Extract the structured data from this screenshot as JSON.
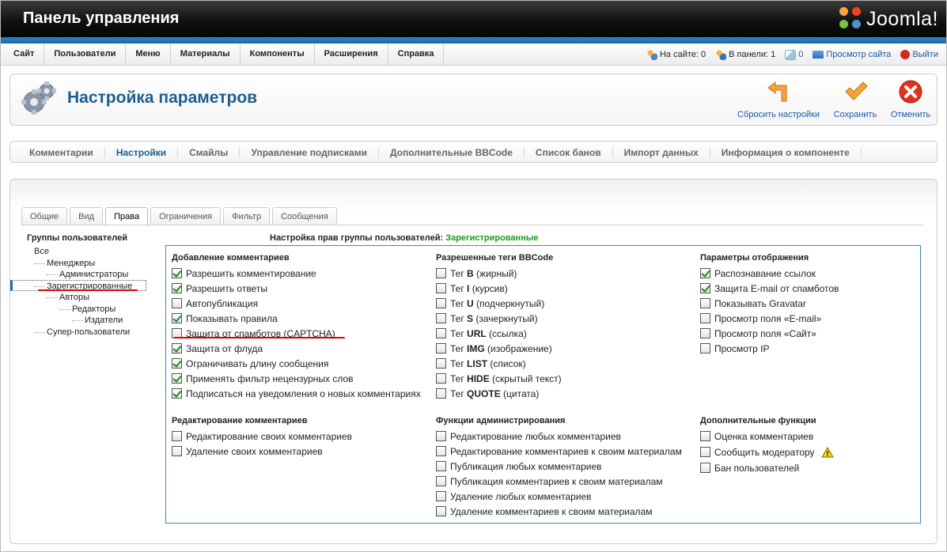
{
  "header": {
    "title": "Панель управления",
    "logo_text": "Joomla!"
  },
  "menu": [
    "Сайт",
    "Пользователи",
    "Меню",
    "Материалы",
    "Компоненты",
    "Расширения",
    "Справка"
  ],
  "status": {
    "on_site": "На сайте: 0",
    "in_panel": "В панели: 1",
    "messages": "0",
    "preview": "Просмотр сайта",
    "logout": "Выйти"
  },
  "toolbar": {
    "title": "Настройка параметров",
    "reset_label": "Сбросить настройки",
    "save_label": "Сохранить",
    "cancel_label": "Отменить"
  },
  "submenu": [
    "Комментарии",
    "Настройки",
    "Смайлы",
    "Управление подписками",
    "Дополнительные BBCode",
    "Список банов",
    "Импорт данных",
    "Информация о компоненте"
  ],
  "submenu_active": 1,
  "tabs": [
    "Общие",
    "Вид",
    "Права",
    "Ограничения",
    "Фильтр",
    "Сообщения"
  ],
  "tabs_active": 2,
  "groups": {
    "title": "Группы пользователей",
    "items": [
      {
        "label": "Все",
        "level": 0
      },
      {
        "label": "Менеджеры",
        "level": 1
      },
      {
        "label": "Администраторы",
        "level": 2
      },
      {
        "label": "Зарегистрированные",
        "level": 1
      },
      {
        "label": "Авторы",
        "level": 2
      },
      {
        "label": "Редакторы",
        "level": 3
      },
      {
        "label": "Издатели",
        "level": 4
      },
      {
        "label": "Супер-пользователи",
        "level": 1
      }
    ],
    "selected": 3
  },
  "rights": {
    "header_prefix": "Настройка прав группы пользователей:",
    "group_name": "Зарегистрированные"
  },
  "sections": {
    "adding": {
      "title": "Добавление комментариев",
      "items": [
        {
          "label": "Разрешить комментирование",
          "checked": true
        },
        {
          "label": "Разрешить ответы",
          "checked": true
        },
        {
          "label": "Автопубликация",
          "checked": false
        },
        {
          "label": "Показывать правила",
          "checked": true
        },
        {
          "label": "Защита от спамботов (CAPTCHA)",
          "checked": false
        },
        {
          "label": "Защита от флуда",
          "checked": true
        },
        {
          "label": "Ограничивать длину сообщения",
          "checked": true
        },
        {
          "label": "Применять фильтр нецензурных слов",
          "checked": true
        },
        {
          "label": "Подписаться на уведомления о новых комментариях",
          "checked": true
        }
      ]
    },
    "bbcode": {
      "title": "Разрешенные теги BBCode",
      "items": [
        {
          "prefix": "Тег ",
          "tag": "B",
          "suffix": " (жирный)",
          "checked": false
        },
        {
          "prefix": "Тег ",
          "tag": "I",
          "suffix": " (курсив)",
          "checked": false
        },
        {
          "prefix": "Тег ",
          "tag": "U",
          "suffix": " (подчеркнутый)",
          "checked": false
        },
        {
          "prefix": "Тег ",
          "tag": "S",
          "suffix": " (зачеркнутый)",
          "checked": false
        },
        {
          "prefix": "Тег ",
          "tag": "URL",
          "suffix": " (ссылка)",
          "checked": false
        },
        {
          "prefix": "Тег ",
          "tag": "IMG",
          "suffix": " (изображение)",
          "checked": false
        },
        {
          "prefix": "Тег ",
          "tag": "LIST",
          "suffix": " (список)",
          "checked": false
        },
        {
          "prefix": "Тег ",
          "tag": "HIDE",
          "suffix": " (скрытый текст)",
          "checked": false
        },
        {
          "prefix": "Тег ",
          "tag": "QUOTE",
          "suffix": " (цитата)",
          "checked": false
        }
      ]
    },
    "display": {
      "title": "Параметры отображения",
      "items": [
        {
          "label": "Распознавание ссылок",
          "checked": true
        },
        {
          "label": "Защита E-mail от спамботов",
          "checked": true
        },
        {
          "label": "Показывать Gravatar",
          "checked": false
        },
        {
          "label": "Просмотр поля «E-mail»",
          "checked": false
        },
        {
          "label": "Просмотр поля «Сайт»",
          "checked": false
        },
        {
          "label": "Просмотр IP",
          "checked": false
        }
      ]
    },
    "editing": {
      "title": "Редактирование комментариев",
      "items": [
        {
          "label": "Редактирование своих комментариев",
          "checked": false
        },
        {
          "label": "Удаление своих комментариев",
          "checked": false
        }
      ]
    },
    "admin": {
      "title": "Функции администрирования",
      "items": [
        {
          "label": "Редактирование любых комментариев",
          "checked": false
        },
        {
          "label": "Редактирование комментариев к своим материалам",
          "checked": false
        },
        {
          "label": "Публикация любых комментариев",
          "checked": false
        },
        {
          "label": "Публикация комментариев к своим материалам",
          "checked": false
        },
        {
          "label": "Удаление любых комментариев",
          "checked": false
        },
        {
          "label": "Удаление комментариев к своим материалам",
          "checked": false
        }
      ]
    },
    "extra": {
      "title": "Дополнительные функции",
      "items": [
        {
          "label": "Оценка комментариев",
          "checked": false
        },
        {
          "label": "Сообщить модератору",
          "checked": false
        },
        {
          "label": "Бан пользователей",
          "checked": false
        }
      ]
    }
  },
  "colors": {
    "accent": "#1b5e8f",
    "header_blue": "#2b83c6",
    "group_green": "#1c9a1c",
    "annotation_red": "#dd0000"
  }
}
